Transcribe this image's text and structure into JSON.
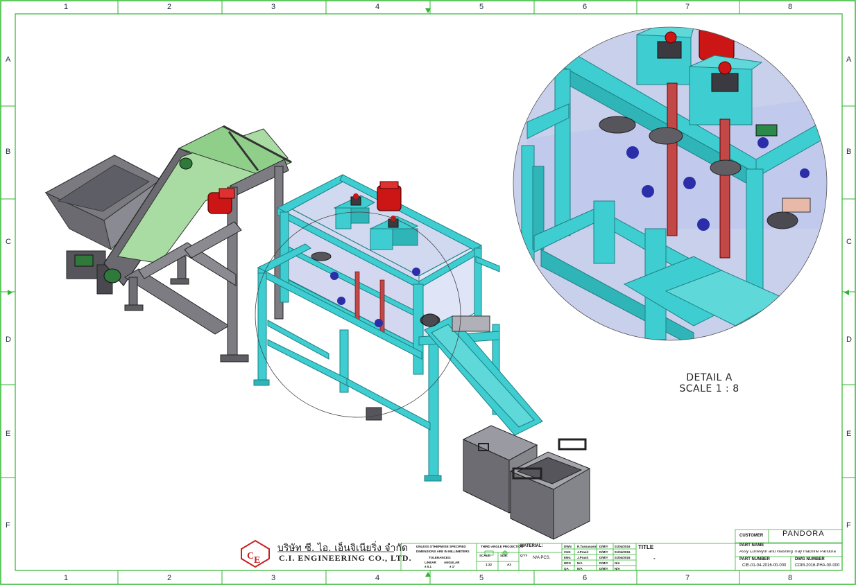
{
  "zones": {
    "columns": [
      "1",
      "2",
      "3",
      "4",
      "5",
      "6",
      "7",
      "8"
    ],
    "rows": [
      "A",
      "B",
      "C",
      "D",
      "E",
      "F"
    ]
  },
  "detail": {
    "label": "DETAIL A",
    "scale": "SCALE 1 : 8"
  },
  "company": {
    "thai_name": "บริษัท ซี. ไอ. เอ็นจิเนียริ่ง จำกัด",
    "english_name": "C.I. ENGINEERING CO., LTD."
  },
  "title_block": {
    "notes_line1": "UNLESS OTHERWISE SPECIFIED",
    "notes_line2": "DIMENSIONS ARE IN MILLIMETERS",
    "tolerances_label": "TOLERANCES:",
    "linear_label": "LINEAR",
    "angular_label": "ANGULAR",
    "linear_value": "± 0.1",
    "angular_value": "± 1°",
    "projection_label": "THIRD ANGLE PROJECTION",
    "scale_label": "SCALE:",
    "scale_value": "1:22",
    "size_label": "SIZE:",
    "size_value": "A3",
    "material_label": "MATERIAL:",
    "qty_label": "Q'TY",
    "qty_value": "N/A PCS.",
    "approvals": [
      {
        "role": "DWN",
        "name": "R.Tassanasin",
        "date_label": "D/M/Y",
        "date": "01/04/2016"
      },
      {
        "role": "CHK",
        "name": "J.Prasit",
        "date_label": "D/M/Y",
        "date": "01/04/2016"
      },
      {
        "role": "ENG",
        "name": "J.Prasit",
        "date_label": "D/M/Y",
        "date": "01/04/2016"
      },
      {
        "role": "MFG",
        "name": "N/A",
        "date_label": "D/M/Y",
        "date": "N/A"
      },
      {
        "role": "QA",
        "name": "N/A",
        "date_label": "D/M/Y",
        "date": "N/A"
      }
    ],
    "title_label": "TITLE",
    "title_value": "-",
    "customer_label": "CUSTOMER",
    "customer_value": "PANDORA",
    "part_name_label": "PART NAME",
    "part_name_value": "Assy Conveyor and Washing Tray machine  Pandora",
    "part_number_label": "PART NUMBER",
    "part_number_value": "CIE-01-04-2016-00-000",
    "dwg_number_label": "DWG NUMBER",
    "dwg_number_value": "COM-2016-PHA-00-000"
  },
  "colors": {
    "frame": "#2fb52f",
    "machine_frame": "#3ecdd0",
    "machine_dark": "#1d7f82",
    "gray_steel": "#7c7c82",
    "gray_dark": "#4a4a50",
    "motor_red": "#cc1515",
    "belt_green": "#a9dca2",
    "glass": "#b9c4e8"
  }
}
